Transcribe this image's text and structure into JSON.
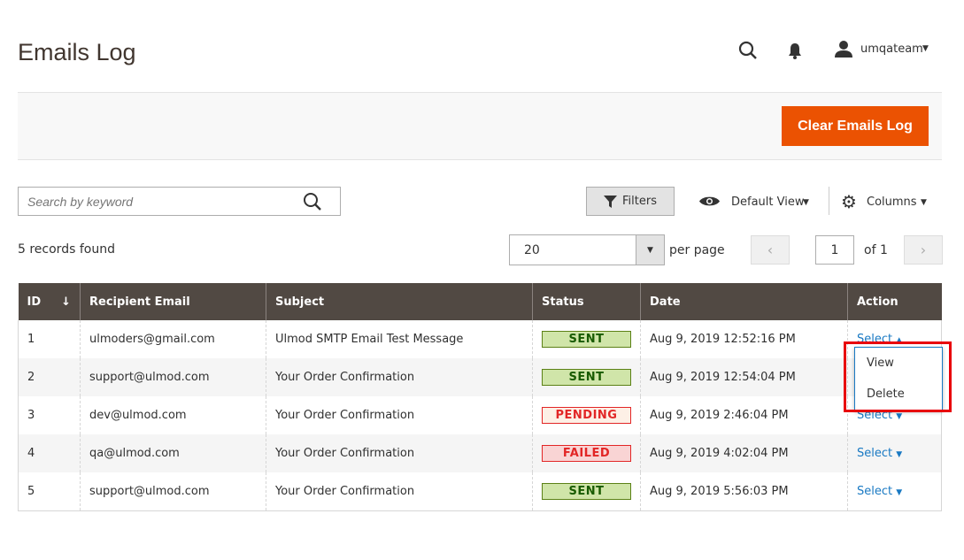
{
  "header": {
    "title": "Emails Log",
    "user": "umqateam",
    "icons": [
      "search-icon",
      "bell-icon",
      "user-icon"
    ]
  },
  "actions": {
    "clear_label": "Clear Emails Log",
    "accent": "#eb5202"
  },
  "toolbar": {
    "search_placeholder": "Search by keyword",
    "filters_label": "Filters",
    "view_label": "Default View",
    "columns_label": "Columns"
  },
  "paging": {
    "records": "5 records found",
    "per_page_value": "20",
    "per_page_label": "per page",
    "page": "1",
    "of": "of 1"
  },
  "table": {
    "columns": [
      "ID",
      "Recipient Email",
      "Subject",
      "Status",
      "Date",
      "Action"
    ],
    "rows": [
      {
        "id": "1",
        "email": "ulmoders@gmail.com",
        "subject": "Ulmod SMTP Email Test Message",
        "status": "SENT",
        "date": "Aug 9, 2019 12:52:16 PM",
        "action": "Select"
      },
      {
        "id": "2",
        "email": "support@ulmod.com",
        "subject": "Your Order Confirmation",
        "status": "SENT",
        "date": "Aug 9, 2019 12:54:04 PM",
        "action": "Select"
      },
      {
        "id": "3",
        "email": "dev@ulmod.com",
        "subject": "Your Order Confirmation",
        "status": "PENDING",
        "date": "Aug 9, 2019 2:46:04 PM",
        "action": "Select"
      },
      {
        "id": "4",
        "email": "qa@ulmod.com",
        "subject": "Your Order Confirmation",
        "status": "FAILED",
        "date": "Aug 9, 2019 4:02:04 PM",
        "action": "Select"
      },
      {
        "id": "5",
        "email": "support@ulmod.com",
        "subject": "Your Order Confirmation",
        "status": "SENT",
        "date": "Aug 9, 2019 5:56:03 PM",
        "action": "Select"
      }
    ]
  },
  "dropdown": {
    "items": [
      "View",
      "Delete"
    ]
  }
}
